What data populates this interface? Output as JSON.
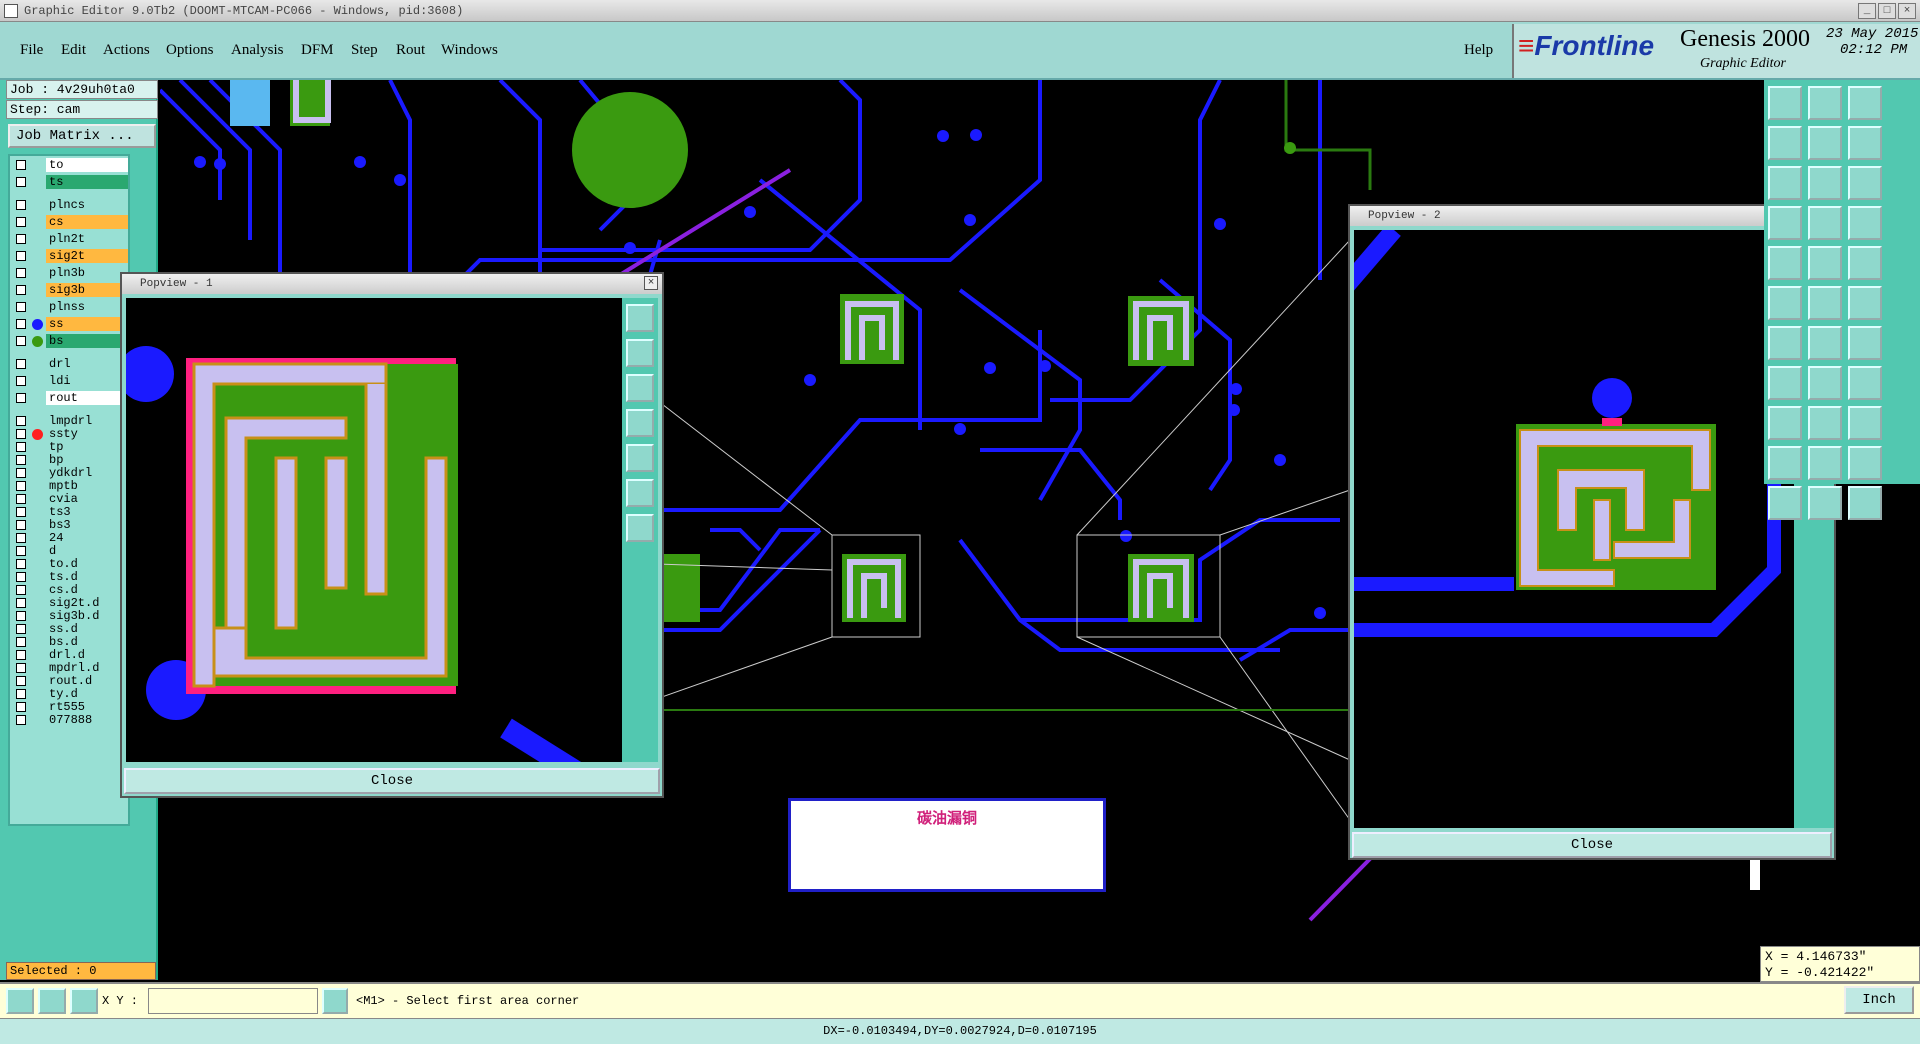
{
  "window": {
    "title": "Graphic Editor 9.0Tb2  (DOOMT-MTCAM-PC066 - Windows, pid:3608)"
  },
  "menu": {
    "items": [
      "File",
      "Edit",
      "Actions",
      "Options",
      "Analysis",
      "DFM",
      "Step",
      "Rout",
      "Windows"
    ],
    "help": "Help"
  },
  "brand": {
    "logo": "Frontline",
    "product": "Genesis 2000",
    "subtitle": "Graphic Editor",
    "date": "23 May 2015",
    "time": "02:12 PM"
  },
  "job": {
    "job_label": "Job  : 4v29uh0ta0",
    "step_label": "Step: cam",
    "matrix_button": "Job Matrix ..."
  },
  "layers": [
    {
      "name": "to",
      "color": "#ffffff",
      "dot": ""
    },
    {
      "name": "ts",
      "color": "#2aa870",
      "dot": ""
    },
    {
      "name": "plncs",
      "color": "#98e0d4",
      "dot": ""
    },
    {
      "name": "cs",
      "color": "#ffb840",
      "dot": ""
    },
    {
      "name": "pln2t",
      "color": "#98e0d4",
      "dot": ""
    },
    {
      "name": "sig2t",
      "color": "#ffb840",
      "dot": ""
    },
    {
      "name": "pln3b",
      "color": "#98e0d4",
      "dot": ""
    },
    {
      "name": "sig3b",
      "color": "#ffb840",
      "dot": ""
    },
    {
      "name": "plnss",
      "color": "#98e0d4",
      "dot": ""
    },
    {
      "name": "ss",
      "color": "#ffb840",
      "dot": "#1a1aff"
    },
    {
      "name": "bs",
      "color": "#2aa870",
      "dot": "#3a9a10"
    },
    {
      "name": "drl",
      "color": "#98e0d4",
      "dot": ""
    },
    {
      "name": "ldi",
      "color": "#98e0d4",
      "dot": ""
    },
    {
      "name": "rout",
      "color": "#ffffff",
      "dot": ""
    },
    {
      "name": "lmpdrl",
      "color": "#98e0d4",
      "dot": ""
    },
    {
      "name": "ssty",
      "color": "#98e0d4",
      "dot": "#ff2020"
    },
    {
      "name": "tp",
      "color": "#98e0d4",
      "dot": ""
    },
    {
      "name": "bp",
      "color": "#98e0d4",
      "dot": ""
    },
    {
      "name": "ydkdrl",
      "color": "#98e0d4",
      "dot": ""
    },
    {
      "name": "mptb",
      "color": "#98e0d4",
      "dot": ""
    },
    {
      "name": "cvia",
      "color": "#98e0d4",
      "dot": ""
    },
    {
      "name": "ts3",
      "color": "#98e0d4",
      "dot": ""
    },
    {
      "name": "bs3",
      "color": "#98e0d4",
      "dot": ""
    },
    {
      "name": "24",
      "color": "#98e0d4",
      "dot": ""
    },
    {
      "name": "d",
      "color": "#98e0d4",
      "dot": ""
    },
    {
      "name": "to.d",
      "color": "#98e0d4",
      "dot": ""
    },
    {
      "name": "ts.d",
      "color": "#98e0d4",
      "dot": ""
    },
    {
      "name": "cs.d",
      "color": "#98e0d4",
      "dot": ""
    },
    {
      "name": "sig2t.d",
      "color": "#98e0d4",
      "dot": ""
    },
    {
      "name": "sig3b.d",
      "color": "#98e0d4",
      "dot": ""
    },
    {
      "name": "ss.d",
      "color": "#98e0d4",
      "dot": ""
    },
    {
      "name": "bs.d",
      "color": "#98e0d4",
      "dot": ""
    },
    {
      "name": "drl.d",
      "color": "#98e0d4",
      "dot": ""
    },
    {
      "name": "mpdrl.d",
      "color": "#98e0d4",
      "dot": ""
    },
    {
      "name": "rout.d",
      "color": "#98e0d4",
      "dot": ""
    },
    {
      "name": "ty.d",
      "color": "#98e0d4",
      "dot": ""
    },
    {
      "name": "rt555",
      "color": "#98e0d4",
      "dot": ""
    },
    {
      "name": "077888",
      "color": "#98e0d4",
      "dot": ""
    }
  ],
  "selected": {
    "label": "Selected : 0"
  },
  "popview1": {
    "title": "Popview - 1",
    "close": "Close"
  },
  "popview2": {
    "title": "Popview - 2",
    "close": "Close"
  },
  "note": {
    "text": "碳油漏铜"
  },
  "coords": {
    "x": "X = 4.146733\"",
    "y": "Y = -0.421422\""
  },
  "command": {
    "xy_label": "X Y :",
    "xy_value": "",
    "prompt": "<M1> - Select first area corner",
    "units": "Inch"
  },
  "status": {
    "text": "DX=-0.0103494,DY=0.0027924,D=0.0107195"
  },
  "colors": {
    "menu_bg": "#9fd8d2",
    "panel_bg": "#52c8b0",
    "trace_blue": "#1a1aff",
    "pad_green": "#3a9a10",
    "copper_lavender": "#c8c0f0",
    "annotation_purple": "#8a20e0"
  }
}
